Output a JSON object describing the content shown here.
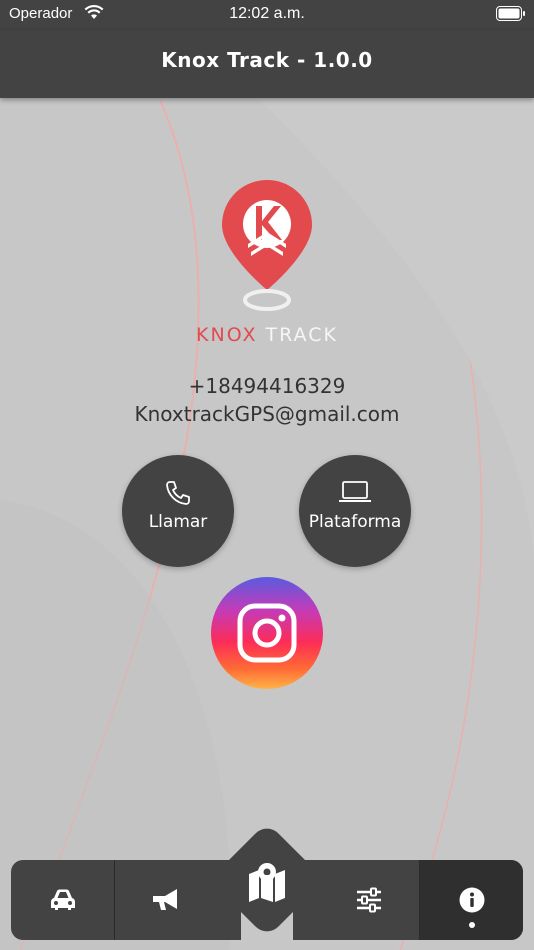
{
  "status_bar": {
    "carrier": "Operador",
    "time": "12:02 a.m."
  },
  "nav": {
    "title": "Knox Track - 1.0.0"
  },
  "brand": {
    "part1": "KNOX",
    "part2": "TRACK"
  },
  "contact": {
    "phone": "+18494416329",
    "email": "KnoxtrackGPS@gmail.com"
  },
  "buttons": {
    "call": "Llamar",
    "platform": "Plataforma"
  },
  "colors": {
    "bar": "#434343",
    "brand_red": "#e34a4e",
    "background": "#c7c7c7"
  },
  "tabs": [
    {
      "icon": "car-icon"
    },
    {
      "icon": "megaphone-icon"
    },
    {
      "icon": "map-icon"
    },
    {
      "icon": "sliders-icon"
    },
    {
      "icon": "info-icon",
      "active": true
    }
  ]
}
